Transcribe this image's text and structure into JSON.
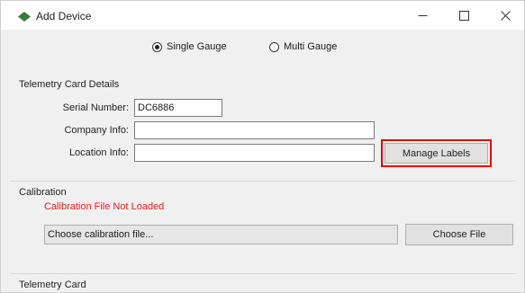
{
  "window": {
    "title": "Add Device",
    "controls": {
      "minimize": "—",
      "maximize": "☐",
      "close": "✕"
    }
  },
  "mode": {
    "options": [
      {
        "label": "Single Gauge",
        "selected": true
      },
      {
        "label": "Multi Gauge",
        "selected": false
      }
    ]
  },
  "telemetry_details": {
    "group_label": "Telemetry Card Details",
    "serial_number": {
      "label": "Serial Number:",
      "value": "DC6886"
    },
    "company_info": {
      "label": "Company Info:",
      "value": ""
    },
    "location_info": {
      "label": "Location Info:",
      "value": ""
    },
    "manage_labels_button": "Manage Labels"
  },
  "calibration": {
    "group_label": "Calibration",
    "status": "Calibration File Not Loaded",
    "file_field": "Choose calibration file...",
    "choose_button": "Choose File"
  },
  "telemetry_card": {
    "group_label": "Telemetry Card"
  },
  "colors": {
    "icon_green": "#3b7a3b",
    "status_red": "#e02020",
    "highlight_red": "#e00000",
    "window_bg": "#f0f0f0"
  }
}
